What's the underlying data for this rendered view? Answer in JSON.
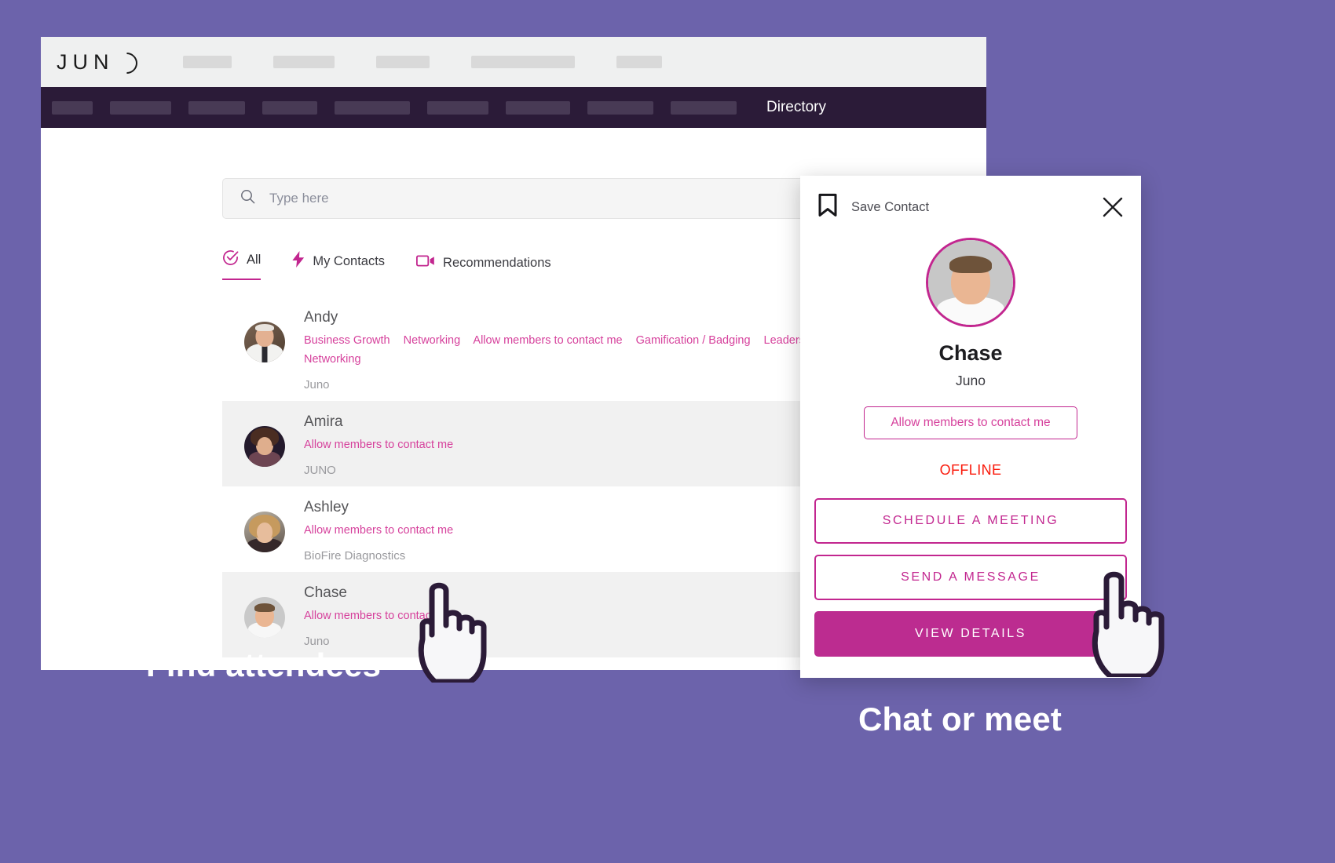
{
  "background_color": "#6c63ab",
  "accent_color": "#c2268f",
  "brand": {
    "logo_text": "JUN",
    "logo_icon": "juno-open-o-logo"
  },
  "nav": {
    "current_item": "Directory",
    "placeholder_count": 9
  },
  "search": {
    "placeholder": "Type here",
    "value": "",
    "icon": "search-icon"
  },
  "tabs": [
    {
      "label": "All",
      "icon": "check-circle-icon",
      "active": true
    },
    {
      "label": "My Contacts",
      "icon": "lightning-bolt-icon",
      "active": false
    },
    {
      "label": "Recommendations",
      "icon": "video-camera-icon",
      "active": false
    }
  ],
  "directory": {
    "rows": [
      {
        "name": "Andy",
        "tags": [
          "Business Growth",
          "Networking",
          "Allow members to contact me",
          "Gamification / Badging",
          "Leadership",
          "Networking"
        ],
        "org": "Juno",
        "shaded": false
      },
      {
        "name": "Amira",
        "tags": [
          "Allow members to contact me"
        ],
        "org": "JUNO",
        "shaded": true
      },
      {
        "name": "Ashley",
        "tags": [
          "Allow members to contact me"
        ],
        "org": "BioFire Diagnostics",
        "shaded": false
      },
      {
        "name": "Chase",
        "tags": [
          "Allow members to contact me"
        ],
        "org": "Juno",
        "shaded": true
      }
    ]
  },
  "contact_card": {
    "save_label": "Save Contact",
    "save_icon": "bookmark-icon",
    "close_icon": "close-icon",
    "avatar_icon": "contact-avatar",
    "name": "Chase",
    "org": "Juno",
    "permission": "Allow members to contact me",
    "status": "OFFLINE",
    "status_color": "#fa1a0b",
    "buttons": [
      {
        "label": "SCHEDULE A MEETING",
        "style": "outline"
      },
      {
        "label": "SEND A MESSAGE",
        "style": "outline"
      },
      {
        "label": "VIEW DETAILS",
        "style": "filled"
      }
    ]
  },
  "captions": {
    "find": "Find attendees",
    "chat": "Chat or meet"
  },
  "cursors": {
    "left": "pointing-hand-cursor",
    "right": "pointing-hand-cursor"
  }
}
